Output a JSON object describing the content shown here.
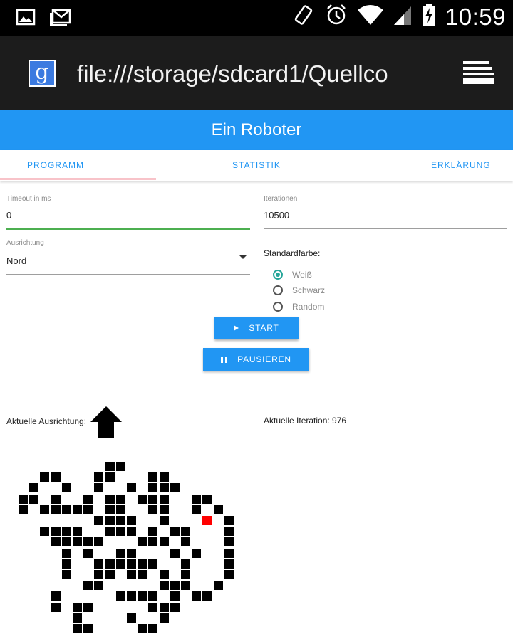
{
  "statusbar": {
    "time": "10:59"
  },
  "browser": {
    "url": "file:///storage/sdcard1/Quellco"
  },
  "app": {
    "title": "Ein Roboter"
  },
  "tabs": [
    {
      "label": "PROGRAMM",
      "active": true
    },
    {
      "label": "STATISTIK",
      "active": false
    },
    {
      "label": "ERKLÄRUNG",
      "active": false
    }
  ],
  "form": {
    "timeout": {
      "label": "Timeout in ms",
      "value": "0"
    },
    "iterations": {
      "label": "Iterationen",
      "value": "10500"
    },
    "direction": {
      "label": "Ausrichtung",
      "value": "Nord"
    },
    "default_color": {
      "label": "Standardfarbe:",
      "options": [
        "Weiß",
        "Schwarz",
        "Random"
      ],
      "selected": "Weiß"
    }
  },
  "buttons": {
    "start": "START",
    "pause": "PAUSIEREN"
  },
  "status": {
    "direction_label": "Aktuelle Ausrichtung:",
    "iteration_text": "Aktuelle Iteration: 976"
  },
  "colors": {
    "primary": "#2196f3",
    "radio_accent": "#26a69a",
    "active_line": "#4caf50",
    "robot": "#ff0000"
  },
  "grid": {
    "robot": [
      17,
      5
    ],
    "cells": [
      [
        8,
        0
      ],
      [
        9,
        0
      ],
      [
        2,
        1
      ],
      [
        3,
        1
      ],
      [
        7,
        1
      ],
      [
        8,
        1
      ],
      [
        12,
        1
      ],
      [
        13,
        1
      ],
      [
        1,
        2
      ],
      [
        4,
        2
      ],
      [
        7,
        2
      ],
      [
        10,
        2
      ],
      [
        12,
        2
      ],
      [
        13,
        2
      ],
      [
        14,
        2
      ],
      [
        0,
        3
      ],
      [
        1,
        3
      ],
      [
        3,
        3
      ],
      [
        6,
        3
      ],
      [
        8,
        3
      ],
      [
        9,
        3
      ],
      [
        11,
        3
      ],
      [
        12,
        3
      ],
      [
        13,
        3
      ],
      [
        16,
        3
      ],
      [
        17,
        3
      ],
      [
        0,
        4
      ],
      [
        2,
        4
      ],
      [
        3,
        4
      ],
      [
        4,
        4
      ],
      [
        5,
        4
      ],
      [
        6,
        4
      ],
      [
        8,
        4
      ],
      [
        9,
        4
      ],
      [
        12,
        4
      ],
      [
        13,
        4
      ],
      [
        16,
        4
      ],
      [
        18,
        4
      ],
      [
        7,
        5
      ],
      [
        8,
        5
      ],
      [
        9,
        5
      ],
      [
        10,
        5
      ],
      [
        13,
        5
      ],
      [
        19,
        5
      ],
      [
        2,
        6
      ],
      [
        3,
        6
      ],
      [
        4,
        6
      ],
      [
        5,
        6
      ],
      [
        8,
        6
      ],
      [
        9,
        6
      ],
      [
        10,
        6
      ],
      [
        12,
        6
      ],
      [
        14,
        6
      ],
      [
        15,
        6
      ],
      [
        19,
        6
      ],
      [
        3,
        7
      ],
      [
        4,
        7
      ],
      [
        5,
        7
      ],
      [
        6,
        7
      ],
      [
        7,
        7
      ],
      [
        11,
        7
      ],
      [
        12,
        7
      ],
      [
        13,
        7
      ],
      [
        15,
        7
      ],
      [
        19,
        7
      ],
      [
        4,
        8
      ],
      [
        6,
        8
      ],
      [
        9,
        8
      ],
      [
        10,
        8
      ],
      [
        14,
        8
      ],
      [
        16,
        8
      ],
      [
        19,
        8
      ],
      [
        4,
        9
      ],
      [
        7,
        9
      ],
      [
        8,
        9
      ],
      [
        9,
        9
      ],
      [
        10,
        9
      ],
      [
        11,
        9
      ],
      [
        12,
        9
      ],
      [
        15,
        9
      ],
      [
        19,
        9
      ],
      [
        4,
        10
      ],
      [
        7,
        10
      ],
      [
        8,
        10
      ],
      [
        10,
        10
      ],
      [
        11,
        10
      ],
      [
        13,
        10
      ],
      [
        15,
        10
      ],
      [
        19,
        10
      ],
      [
        6,
        11
      ],
      [
        7,
        11
      ],
      [
        13,
        11
      ],
      [
        14,
        11
      ],
      [
        15,
        11
      ],
      [
        18,
        11
      ],
      [
        3,
        12
      ],
      [
        9,
        12
      ],
      [
        10,
        12
      ],
      [
        11,
        12
      ],
      [
        12,
        12
      ],
      [
        14,
        12
      ],
      [
        16,
        12
      ],
      [
        17,
        12
      ],
      [
        3,
        13
      ],
      [
        5,
        13
      ],
      [
        6,
        13
      ],
      [
        12,
        13
      ],
      [
        13,
        13
      ],
      [
        14,
        13
      ],
      [
        5,
        14
      ],
      [
        10,
        14
      ],
      [
        13,
        14
      ],
      [
        5,
        15
      ],
      [
        6,
        15
      ],
      [
        11,
        15
      ],
      [
        12,
        15
      ]
    ]
  }
}
